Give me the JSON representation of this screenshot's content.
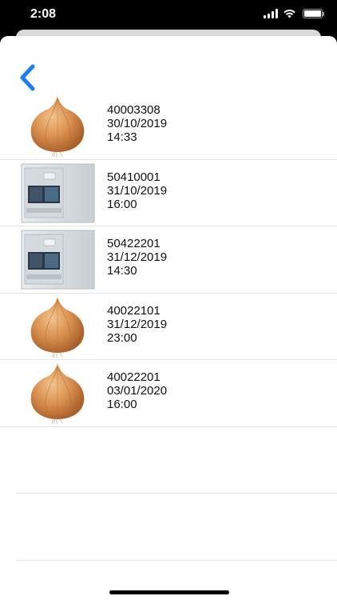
{
  "status_bar": {
    "time": "2:08"
  },
  "navigation": {
    "back_icon": "chevron-left-icon",
    "accent_color": "#1a7ef5"
  },
  "items": [
    {
      "code": "40003308",
      "date": "30/10/2019",
      "time": "14:33",
      "image": "onion"
    },
    {
      "code": "50410001",
      "date": "31/10/2019",
      "time": "16:00",
      "image": "reefer-container"
    },
    {
      "code": "50422201",
      "date": "31/12/2019",
      "time": "14:30",
      "image": "reefer-container"
    },
    {
      "code": "40022101",
      "date": "31/12/2019",
      "time": "23:00",
      "image": "onion"
    },
    {
      "code": "40022201",
      "date": "03/01/2020",
      "time": "16:00",
      "image": "onion"
    }
  ]
}
